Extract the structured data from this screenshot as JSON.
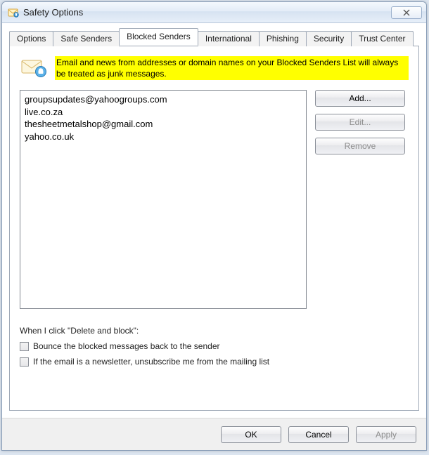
{
  "window": {
    "title": "Safety Options"
  },
  "tabs": {
    "items": [
      {
        "label": "Options"
      },
      {
        "label": "Safe Senders"
      },
      {
        "label": "Blocked Senders",
        "active": true
      },
      {
        "label": "International"
      },
      {
        "label": "Phishing"
      },
      {
        "label": "Security"
      },
      {
        "label": "Trust Center"
      }
    ]
  },
  "panel": {
    "info_text": "Email and news from addresses or domain names on your Blocked Senders List will always be treated as junk messages.",
    "blocked_list": [
      "groupsupdates@yahoogroups.com",
      "live.co.za",
      "thesheetmetalshop@gmail.com",
      "yahoo.co.uk"
    ],
    "buttons": {
      "add": "Add...",
      "edit": "Edit...",
      "remove": "Remove"
    },
    "delete_block_heading": "When I click \"Delete and block\":",
    "checkbox_bounce": "Bounce the blocked messages back to the sender",
    "checkbox_unsubscribe": "If the email is a newsletter, unsubscribe me from the mailing list"
  },
  "footer": {
    "ok": "OK",
    "cancel": "Cancel",
    "apply": "Apply"
  }
}
